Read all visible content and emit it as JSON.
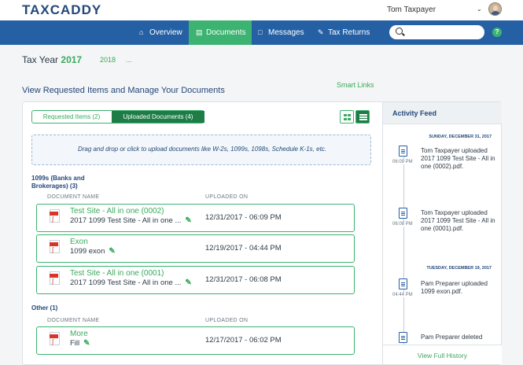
{
  "brand": {
    "logo": "TAXCADDY",
    "user_name": "Tom Taxpayer"
  },
  "nav": {
    "items": [
      {
        "label": "Overview",
        "icon": "home-icon"
      },
      {
        "label": "Documents",
        "icon": "document-icon",
        "active": true
      },
      {
        "label": "Messages",
        "icon": "chat-icon"
      },
      {
        "label": "Tax Returns",
        "icon": "edit-icon"
      }
    ],
    "search_placeholder": "",
    "help": "?"
  },
  "tax_year": {
    "label": "Tax Year",
    "current": "2017",
    "other": "2018",
    "more": "..."
  },
  "page": {
    "heading": "View Requested Items and Manage Your Documents",
    "smart_links": "Smart Links"
  },
  "tabs": {
    "requested": "Requested Items (2)",
    "uploaded": "Uploaded Documents (4)"
  },
  "dropzone": "Drag and drop or click to upload documents like W-2s, 1099s, 1098s, Schedule K-1s, etc.",
  "groups": [
    {
      "title": "1099s (Banks and Brokerages) (3)",
      "col_name": "DOCUMENT NAME",
      "col_date": "UPLOADED ON",
      "rows": [
        {
          "name": "Test Site - All in one (0002)",
          "desc": "2017 1099 Test Site - All in one ...",
          "date": "12/31/2017 - 06:09 PM"
        },
        {
          "name": "Exon",
          "desc": "1099 exon",
          "date": "12/19/2017 - 04:44 PM"
        },
        {
          "name": "Test Site - All in one (0001)",
          "desc": "2017 1099 Test Site - All in one ...",
          "date": "12/31/2017 - 06:08 PM"
        }
      ]
    },
    {
      "title": "Other (1)",
      "col_name": "DOCUMENT NAME",
      "col_date": "UPLOADED ON",
      "rows": [
        {
          "name": "More",
          "desc": "Fill",
          "date": "12/17/2017 - 06:02 PM"
        }
      ]
    }
  ],
  "feed": {
    "title": "Activity Feed",
    "dates": [
      "SUNDAY, DECEMBER 31, 2017",
      "TUESDAY, DECEMBER 19, 2017"
    ],
    "entries": [
      {
        "time": "06:09 PM",
        "text": "Tom Taxpayer uploaded 2017 1099 Test Site - All in one (0002).pdf."
      },
      {
        "time": "06:08 PM",
        "text": "Tom Taxpayer uploaded 2017 1099 Test Site - All in one (0001).pdf."
      },
      {
        "time": "04:44 PM",
        "text": "Pam Preparer uploaded 1099 exon.pdf."
      },
      {
        "time": "",
        "text": "Pam Preparer deleted"
      }
    ],
    "footer": "View Full History"
  },
  "colors": {
    "brand_blue": "#2560a4",
    "brand_green": "#3cb371",
    "dark_green": "#1e7d46",
    "pdf_red": "#d9342b"
  }
}
